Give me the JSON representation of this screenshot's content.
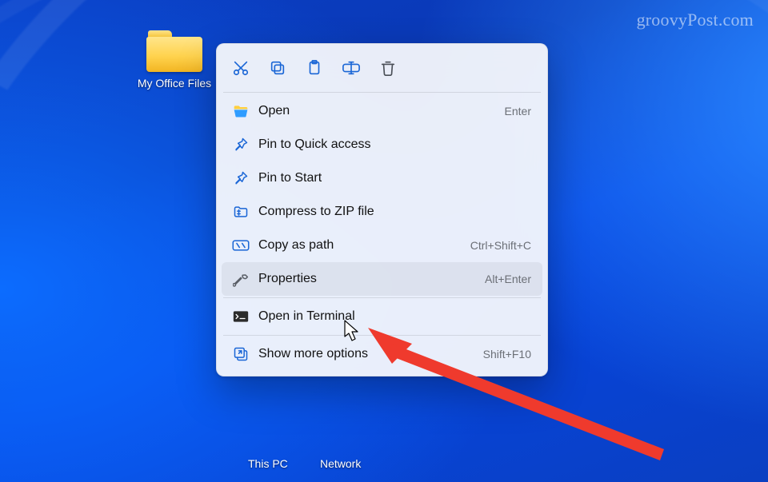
{
  "watermark": "groovyPost.com",
  "desktop": {
    "folder_label": "My Office Files",
    "labels": {
      "this_pc": "This PC",
      "network": "Network"
    }
  },
  "context_menu": {
    "icon_row": [
      "cut",
      "copy",
      "paste",
      "rename",
      "delete"
    ],
    "items": [
      {
        "icon": "folder-open",
        "label": "Open",
        "shortcut": "Enter"
      },
      {
        "icon": "pin",
        "label": "Pin to Quick access",
        "shortcut": ""
      },
      {
        "icon": "pin",
        "label": "Pin to Start",
        "shortcut": ""
      },
      {
        "icon": "zip",
        "label": "Compress to ZIP file",
        "shortcut": ""
      },
      {
        "icon": "copy-path",
        "label": "Copy as path",
        "shortcut": "Ctrl+Shift+C"
      },
      {
        "icon": "wrench",
        "label": "Properties",
        "shortcut": "Alt+Enter",
        "hovered": true
      },
      {
        "icon": "terminal",
        "label": "Open in Terminal",
        "shortcut": ""
      },
      {
        "icon": "more",
        "label": "Show more options",
        "shortcut": "Shift+F10"
      }
    ]
  }
}
